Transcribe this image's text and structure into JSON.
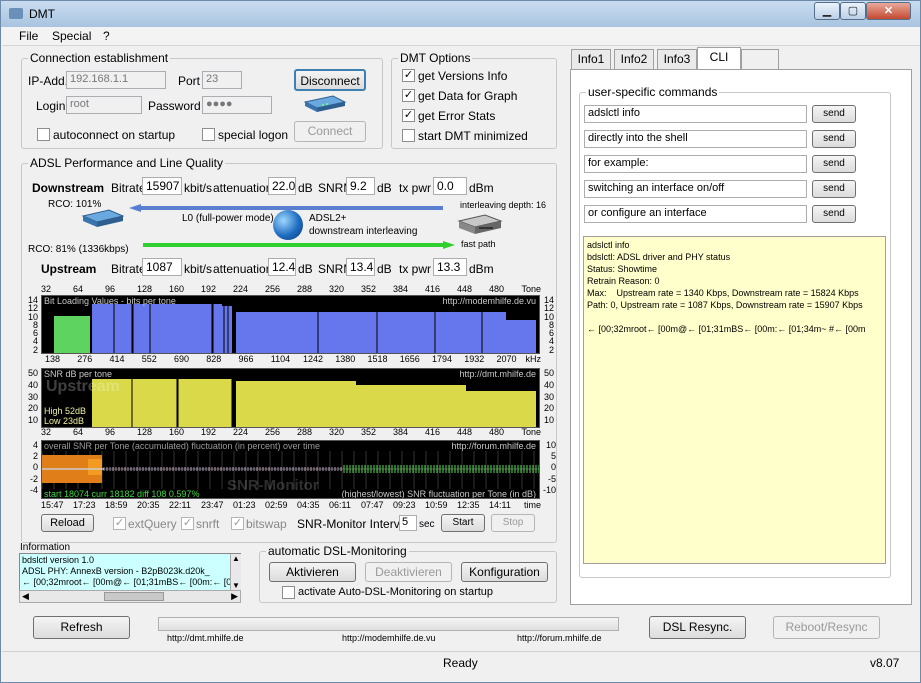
{
  "window": {
    "title": "DMT",
    "min": "▁",
    "max": "▢",
    "close": "✕"
  },
  "menu": [
    "File",
    "Special",
    "?"
  ],
  "connection": {
    "group_label": "Connection establishment",
    "ip_label": "IP-Add.",
    "ip_value": "192.168.1.1",
    "port_label": "Port",
    "port_value": "23",
    "login_label": "Login",
    "login_value": "root",
    "password_label": "Password",
    "password_value": "●●●●",
    "disconnect": "Disconnect",
    "connect": "Connect",
    "autoconnect": "autoconnect on startup",
    "special_logon": "special logon"
  },
  "dmt_options": {
    "group_label": "DMT Options",
    "items": [
      {
        "label": "get Versions Info",
        "checked": "✓"
      },
      {
        "label": "get Data for Graph",
        "checked": "✓"
      },
      {
        "label": "get Error Stats",
        "checked": "✓"
      },
      {
        "label": "start DMT minimized",
        "checked": ""
      }
    ]
  },
  "adsl": {
    "group_label": "ADSL Performance and Line Quality",
    "down_label": "Downstream",
    "up_label": "Upstream",
    "bitrate_label": "Bitrate",
    "kbits": "kbit/s",
    "atten_label": "attenuation",
    "db": "dB",
    "snrm_label": "SNRM",
    "txpwr_label": "tx pwr",
    "dbm": "dBm",
    "down": {
      "bitrate": "15907",
      "atten": "22.0",
      "snrm": "9.2",
      "txpwr": "0.0"
    },
    "up": {
      "bitrate": "1087",
      "atten": "12.4",
      "snrm": "13.4",
      "txpwr": "13.3"
    },
    "rco_top": "RCO: 101%",
    "rco_bottom": "RCO: 81% (1336kbps)",
    "mode": "L0 (full-power mode)",
    "standard": "ADSL2+",
    "interleave_text": "downstream interleaving",
    "interleave_depth": "interleaving depth: 16",
    "fast_path": "fast path"
  },
  "charts": {
    "bits": {
      "title": "Bit Loading Values - bits per tone",
      "url": "http://modemhilfe.de.vu",
      "yticks": [
        "14",
        "12",
        "10",
        "8",
        "6",
        "4",
        "2"
      ]
    },
    "snr": {
      "title": "SNR  dB per tone",
      "url": "http://dmt.mhilfe.de",
      "yticks": [
        "50",
        "40",
        "30",
        "20",
        "10"
      ],
      "overlay": "Upstream",
      "high": "High 52dB",
      "low": "Low  23dB"
    },
    "mon": {
      "title": "overall SNR per Tone (accumulated) fluctuation (in percent) over time",
      "url": "http://forum.mhilfe.de",
      "left_yticks": [
        "4",
        "2",
        "0",
        "-2",
        "-4"
      ],
      "right_yticks": [
        "10",
        "5",
        "0",
        "-5",
        "-10"
      ],
      "stats": "start 18074  curr 18182  diff  108        0.597%",
      "caption": "(highest/lowest) SNR fluctuation per Tone (in dB)",
      "watermark": "SNR-Monitor"
    },
    "tone_ticks": [
      "32",
      "64",
      "96",
      "128",
      "160",
      "192",
      "224",
      "256",
      "288",
      "320",
      "352",
      "384",
      "416",
      "448",
      "480"
    ],
    "tone_label": "Tone",
    "khz_ticks": [
      "138",
      "276",
      "414",
      "552",
      "690",
      "828",
      "966",
      "1104",
      "1242",
      "1380",
      "1518",
      "1656",
      "1794",
      "1932",
      "2070"
    ],
    "khz_label": "kHz",
    "time_ticks": [
      "15:47",
      "17:23",
      "18:59",
      "20:35",
      "22:11",
      "23:47",
      "01:23",
      "02:59",
      "04:35",
      "06:11",
      "07:47",
      "09:23",
      "10:59",
      "12:35",
      "14:11"
    ],
    "time_label": "time"
  },
  "controls": {
    "reload": "Reload",
    "extquery": "extQuery",
    "snrft": "snrft",
    "bitswap": "bitswap",
    "interval_label": "SNR-Monitor Interval:",
    "interval_value": "5",
    "sec": "sec",
    "start": "Start",
    "stop": "Stop"
  },
  "information": {
    "label": "Information",
    "lines": [
      "bdslctl version 1.0",
      "ADSL PHY: AnnexB version - B2pB023k.d20k_",
      "← [00;32mroot← [00m@← [01;31mBS← [00m:← [0"
    ]
  },
  "monitoring": {
    "group_label": "automatic DSL-Monitoring",
    "activate": "Aktivieren",
    "deactivate": "Deaktivieren",
    "config": "Konfiguration",
    "startup": "activate Auto-DSL-Monitoring on startup"
  },
  "tabs": [
    "Info1",
    "Info2",
    "Info3",
    "CLI"
  ],
  "cli": {
    "group_label": "user-specific commands",
    "commands": [
      "adslctl info",
      "directly into the shell",
      "for example:",
      "switching an interface on/off",
      "or configure an interface"
    ],
    "send": "send",
    "log": "adslctl info\nbdslctl: ADSL driver and PHY status\nStatus: Showtime\nRetrain Reason: 0\nMax:    Upstream rate = 1340 Kbps, Downstream rate = 15824 Kbps\nPath: 0, Upstream rate = 1087 Kbps, Downstream rate = 15907 Kbps\n\n← [00;32mroot← [00m@← [01;31mBS← [00m:← [01;34m~ #← [00m"
  },
  "bottom": {
    "refresh": "Refresh",
    "resync": "DSL Resync.",
    "reboot": "Reboot/Resync",
    "links": [
      "http://dmt.mhilfe.de",
      "http://modemhilfe.de.vu",
      "http://forum.mhilfe.de"
    ]
  },
  "status": {
    "text": "Ready",
    "version": "v8.07"
  }
}
